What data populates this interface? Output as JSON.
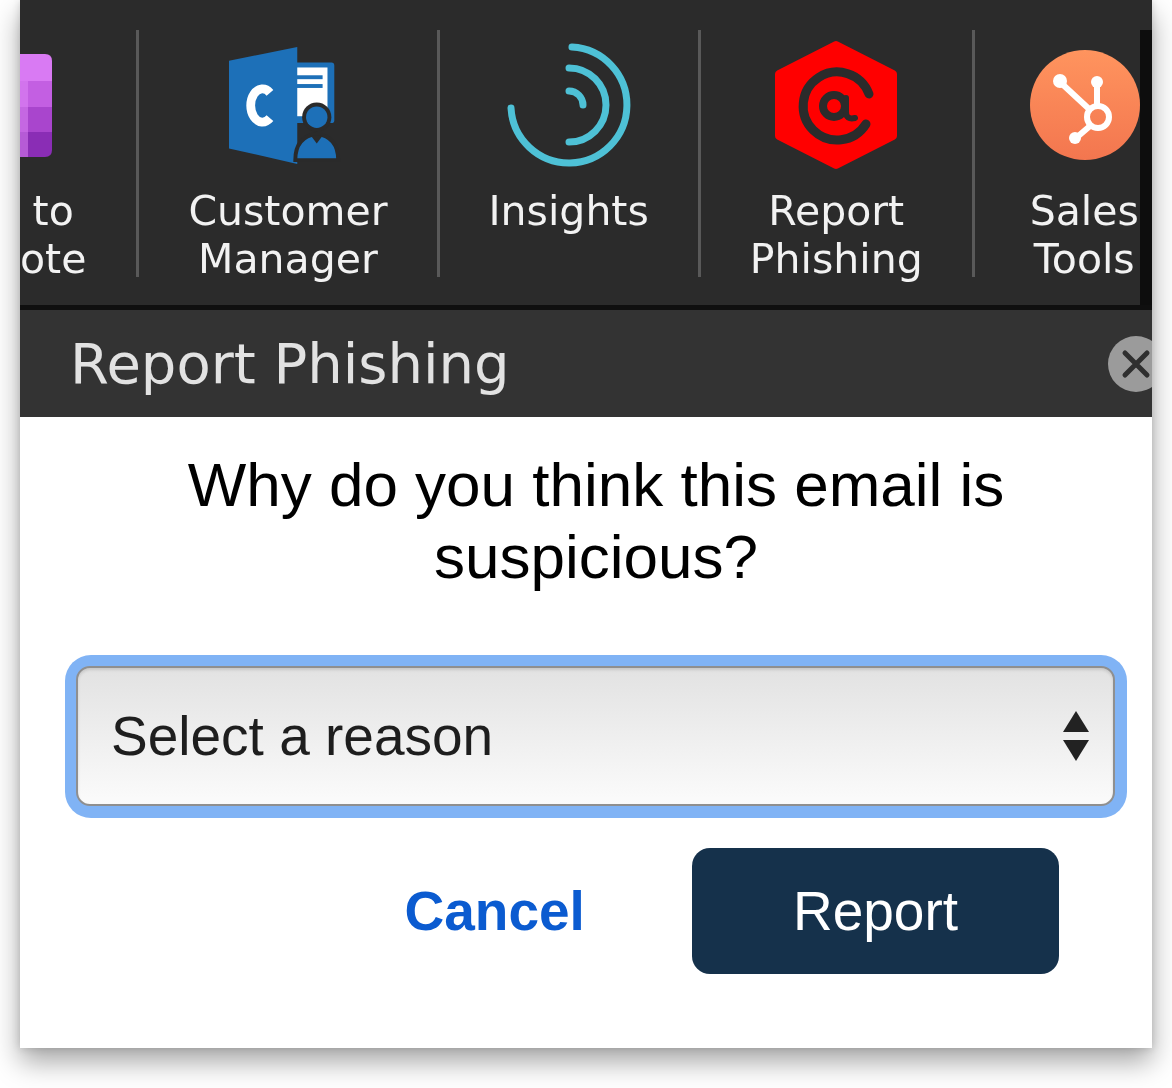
{
  "ribbon": {
    "items": [
      {
        "label": "to ote"
      },
      {
        "label": "Customer Manager"
      },
      {
        "label": "Insights"
      },
      {
        "label": "Report Phishing"
      },
      {
        "label": "Sales Tools"
      }
    ]
  },
  "pane": {
    "title": "Report Phishing"
  },
  "question": "Why do you think this email is suspicious?",
  "reason_select": {
    "value": "Select a reason",
    "focused": true
  },
  "buttons": [
    {
      "label": "Cancel",
      "kind": "link"
    },
    {
      "label": "Report",
      "kind": "primary"
    }
  ]
}
